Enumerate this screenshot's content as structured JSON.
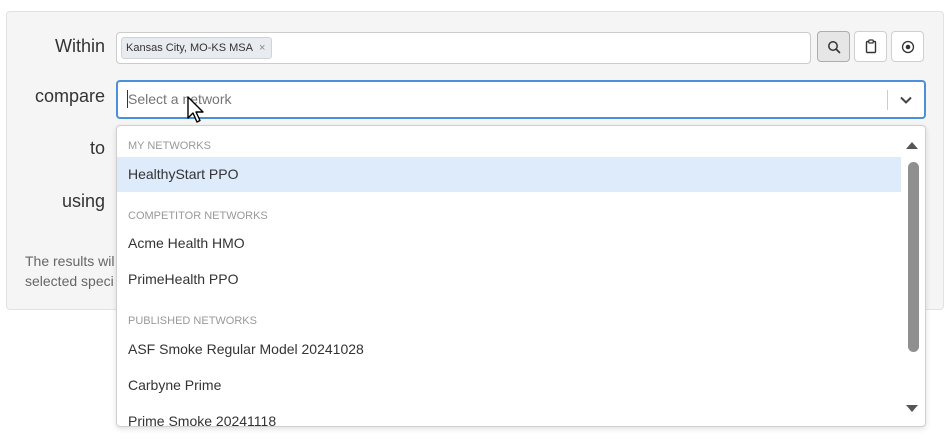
{
  "form": {
    "within_label": "Within",
    "compare_label": "compare",
    "to_label": "to",
    "using_label": "using",
    "within_tag": "Kansas City, MO-KS MSA",
    "within_tag_remove": "×",
    "compare_placeholder": "Select a network",
    "hint_line1": "The results wil",
    "hint_line2": "selected speci"
  },
  "buttons": [
    {
      "name": "search-button",
      "icon": "search-icon"
    },
    {
      "name": "clipboard-button",
      "icon": "clipboard-icon"
    },
    {
      "name": "target-button",
      "icon": "radio-target-icon"
    }
  ],
  "dropdown": {
    "groups": [
      {
        "header": "MY NETWORKS",
        "options": [
          "HealthyStart PPO"
        ]
      },
      {
        "header": "COMPETITOR NETWORKS",
        "options": [
          "Acme Health HMO",
          "PrimeHealth PPO"
        ]
      },
      {
        "header": "PUBLISHED NETWORKS",
        "options": [
          "ASF Smoke Regular Model 20241028",
          "Carbyne Prime",
          "Prime Smoke 20241118"
        ]
      }
    ],
    "highlighted": "HealthyStart PPO"
  },
  "colors": {
    "focus_border": "#4a90d9",
    "highlight_bg": "#deebfb",
    "panel_bg": "#f5f5f5"
  }
}
